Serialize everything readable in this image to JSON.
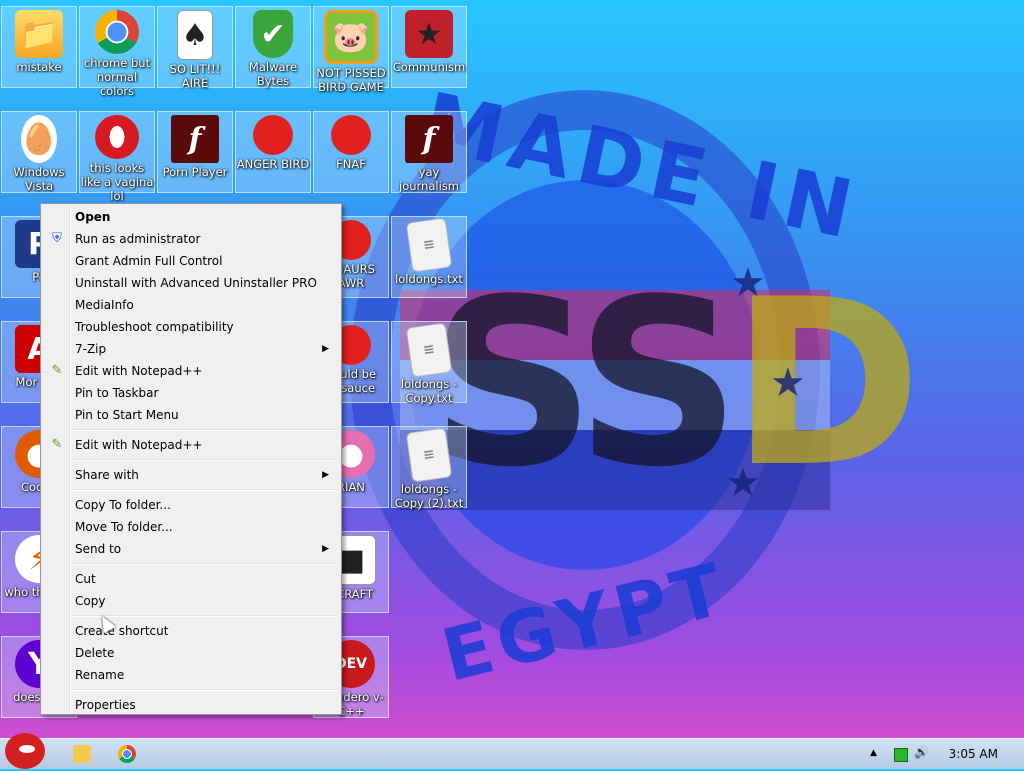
{
  "desktop": {
    "icons": [
      {
        "label": "mistake",
        "glyph": "📁"
      },
      {
        "label": "chrome but normal colors",
        "glyph": ""
      },
      {
        "label": "SO LIT!!! AIRE",
        "glyph": "♠"
      },
      {
        "label": "Malware Bytes",
        "glyph": "✔"
      },
      {
        "label": "NOT PISSED BIRD GAME",
        "glyph": "🐷"
      },
      {
        "label": "Communism",
        "glyph": "★"
      },
      {
        "label": "Windows Vista",
        "glyph": "🥚"
      },
      {
        "label": "this looks like a vagina lol",
        "glyph": ""
      },
      {
        "label": "Porn Player",
        "glyph": "f"
      },
      {
        "label": "ANGER BIRD",
        "glyph": "●"
      },
      {
        "label": "FNAF",
        "glyph": "●"
      },
      {
        "label": "yay journalism",
        "glyph": "f"
      },
      {
        "label": "Pe",
        "glyph": "P"
      },
      {
        "label": "DSAURS AWR",
        "glyph": "●"
      },
      {
        "label": "loldongs.txt",
        "glyph": "≡"
      },
      {
        "label": "Mor Rea",
        "glyph": "A"
      },
      {
        "label": "hould be nesauce",
        "glyph": "●"
      },
      {
        "label": "loldongs - Copy.txt",
        "glyph": "≡"
      },
      {
        "label": "CockC",
        "glyph": "●"
      },
      {
        "label": "RIAN",
        "glyph": "●"
      },
      {
        "label": "loldongs - Copy (2).txt",
        "glyph": "≡"
      },
      {
        "label": "who th uses",
        "glyph": "⚡"
      },
      {
        "label": "ECRAFT",
        "glyph": "■"
      },
      {
        "label": "doesn' lo",
        "glyph": "Y"
      },
      {
        "label": "arcadero v-C++",
        "glyph": "DEV"
      }
    ]
  },
  "context_menu": {
    "items": [
      {
        "label": "Open"
      },
      {
        "label": "Run as administrator",
        "icon": "shield-icon"
      },
      {
        "label": "Grant Admin Full Control"
      },
      {
        "label": "Uninstall with Advanced Uninstaller PRO"
      },
      {
        "label": "MediaInfo"
      },
      {
        "label": "Troubleshoot compatibility"
      },
      {
        "label": "7-Zip"
      },
      {
        "label": "Edit with Notepad++",
        "icon": "notepad-icon"
      },
      {
        "label": "Pin to Taskbar"
      },
      {
        "label": "Pin to Start Menu"
      },
      {
        "label": "Edit with Notepad++",
        "icon": "notepad-icon"
      },
      {
        "label": "Share with"
      },
      {
        "label": "Copy To folder..."
      },
      {
        "label": "Move To folder..."
      },
      {
        "label": "Send to"
      },
      {
        "label": "Cut"
      },
      {
        "label": "Copy"
      },
      {
        "label": "Create shortcut"
      },
      {
        "label": "Delete"
      },
      {
        "label": "Rename"
      },
      {
        "label": "Properties"
      }
    ]
  },
  "wallpaper": {
    "top_text": "MADE IN",
    "letters_a": "SS",
    "letters_b": "D",
    "bottom_text": "EGYPT"
  },
  "taskbar": {
    "clock": "3:05 AM",
    "tray_chevron": "▲",
    "volume": "🔊"
  },
  "colors": {
    "menu_bg": "#f0f0f0",
    "taskbar": "#c4d7ee"
  }
}
